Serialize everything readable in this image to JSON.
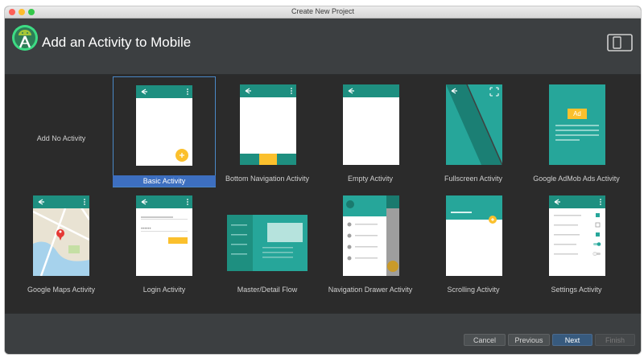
{
  "window": {
    "title": "Create New Project"
  },
  "header": {
    "title": "Add an Activity to Mobile",
    "logo_icon": "android-studio-logo-icon",
    "device_icon": "phone-tablet-icon"
  },
  "activities": [
    {
      "label": "Add No Activity"
    },
    {
      "label": "Basic Activity",
      "selected": true
    },
    {
      "label": "Bottom Navigation Activity"
    },
    {
      "label": "Empty Activity"
    },
    {
      "label": "Fullscreen Activity"
    },
    {
      "label": "Google AdMob Ads Activity",
      "ad_badge": "Ad"
    },
    {
      "label": "Google Maps Activity"
    },
    {
      "label": "Login Activity"
    },
    {
      "label": "Master/Detail Flow"
    },
    {
      "label": "Navigation Drawer Activity"
    },
    {
      "label": "Scrolling Activity"
    },
    {
      "label": "Settings Activity"
    }
  ],
  "footer": {
    "cancel": "Cancel",
    "previous": "Previous",
    "next": "Next",
    "finish": "Finish"
  },
  "colors": {
    "accent": "#26a69a",
    "toolbar": "#1e8f80",
    "fab": "#fbc02d",
    "selection": "#3d6fc0"
  }
}
